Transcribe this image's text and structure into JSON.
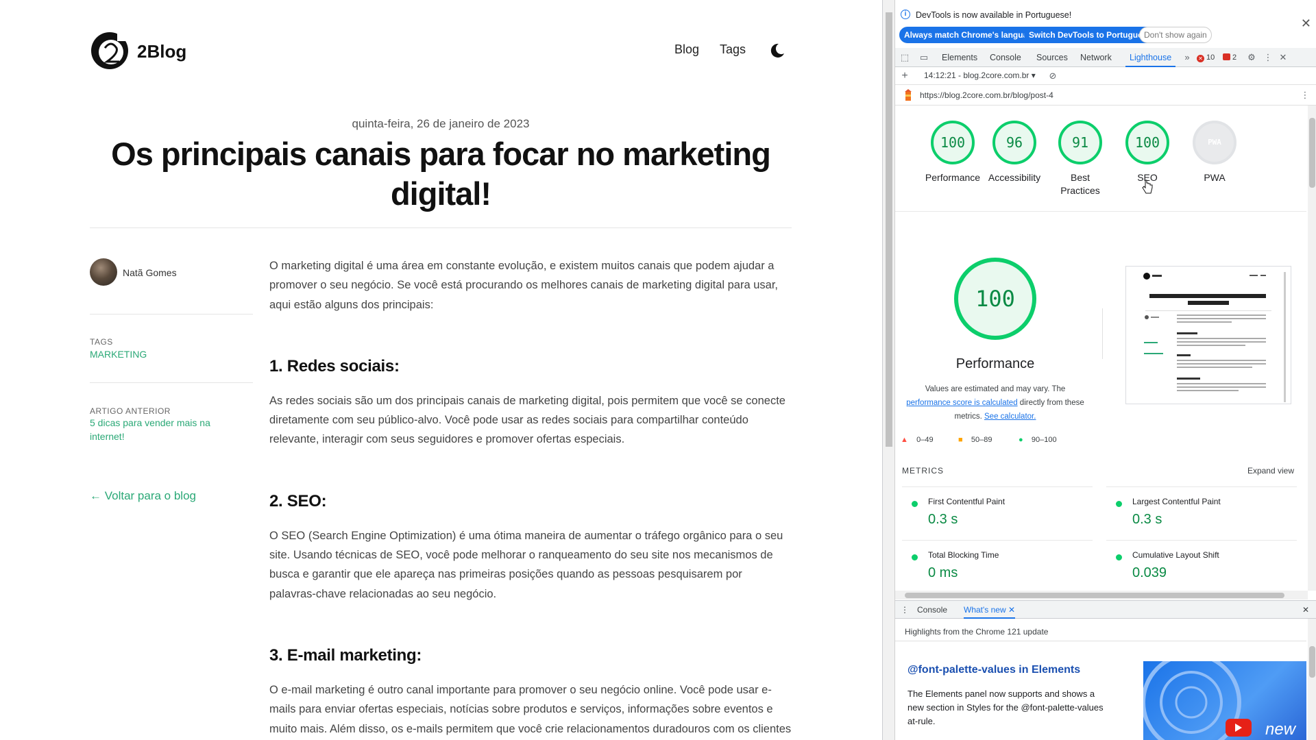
{
  "blog": {
    "brand": "2Blog",
    "nav": {
      "blog": "Blog",
      "tags": "Tags"
    },
    "date": "quinta-feira, 26 de janeiro de 2023",
    "title": "Os principais canais para focar no marketing digital!",
    "author": "Natã Gomes",
    "tags_label": "TAGS",
    "tag": "MARKETING",
    "prev_label": "ARTIGO ANTERIOR",
    "prev_title": "5 dicas para vender mais na internet!",
    "back": "← Voltar para o blog",
    "intro": "O marketing digital é uma área em constante evolução, e existem muitos canais que podem ajudar a promover o seu negócio. Se você está procurando os melhores canais de marketing digital para usar, aqui estão alguns dos principais:",
    "sections": [
      {
        "heading": "1. Redes sociais:",
        "text": "As redes sociais são um dos principais canais de marketing digital, pois permitem que você se conecte diretamente com seu público-alvo. Você pode usar as redes sociais para compartilhar conteúdo relevante, interagir com seus seguidores e promover ofertas especiais."
      },
      {
        "heading": "2. SEO:",
        "text": "O SEO (Search Engine Optimization) é uma ótima maneira de aumentar o tráfego orgânico para o seu site. Usando técnicas de SEO, você pode melhorar o ranqueamento do seu site nos mecanismos de busca e garantir que ele apareça nas primeiras posições quando as pessoas pesquisarem por palavras-chave relacionadas ao seu negócio."
      },
      {
        "heading": "3. E-mail marketing:",
        "text": "O e-mail marketing é outro canal importante para promover o seu negócio online. Você pode usar e-mails para enviar ofertas especiais, notícias sobre produtos e serviços, informações sobre eventos e muito mais. Além disso, os e-mails permitem que você crie relacionamentos duradouros com os clientes atuais e potenciais."
      }
    ]
  },
  "devtools": {
    "info_text": "DevTools is now available in Portuguese!",
    "btn_match": "Always match Chrome's language",
    "btn_switch": "Switch DevTools to Portuguese",
    "btn_dont_show": "Don't show again",
    "tabs": [
      "Elements",
      "Console",
      "Sources",
      "Network",
      "Lighthouse"
    ],
    "active_tab": "Lighthouse",
    "errors_count": "10",
    "issues_count": "2",
    "report_selector": "14:12:21 - blog.2core.com.br",
    "url": "https://blog.2core.com.br/blog/post-4",
    "scores": [
      {
        "value": "100",
        "label": "Performance"
      },
      {
        "value": "96",
        "label": "Accessibility"
      },
      {
        "value": "91",
        "label": "Best Practices"
      },
      {
        "value": "100",
        "label": "SEO"
      },
      {
        "value": "PWA",
        "label": "PWA"
      }
    ],
    "perf_score": "100",
    "perf_label": "Performance",
    "est_prefix": "Values are estimated and may vary. The",
    "est_link1": "performance score is calculated",
    "est_mid": "directly from these metrics.",
    "est_link2": "See calculator.",
    "legend": [
      "0–49",
      "50–89",
      "90–100"
    ],
    "metrics_heading": "METRICS",
    "expand_view": "Expand view",
    "metrics": [
      {
        "name": "First Contentful Paint",
        "value": "0.3 s"
      },
      {
        "name": "Largest Contentful Paint",
        "value": "0.3 s"
      },
      {
        "name": "Total Blocking Time",
        "value": "0 ms"
      },
      {
        "name": "Cumulative Layout Shift",
        "value": "0.039"
      }
    ],
    "drawer": {
      "tab_console": "Console",
      "tab_whats_new": "What's new",
      "highlights": "Highlights from the Chrome 121 update",
      "title": "@font-palette-values in Elements",
      "desc": "The Elements panel now supports and shows a new section in Styles for the @font-palette-values at-rule.",
      "img_text": "new"
    },
    "colors": {
      "accent": "#1a73e8",
      "pass": "#0cce6b",
      "average": "#ffa400",
      "fail": "#ff4e42"
    }
  }
}
